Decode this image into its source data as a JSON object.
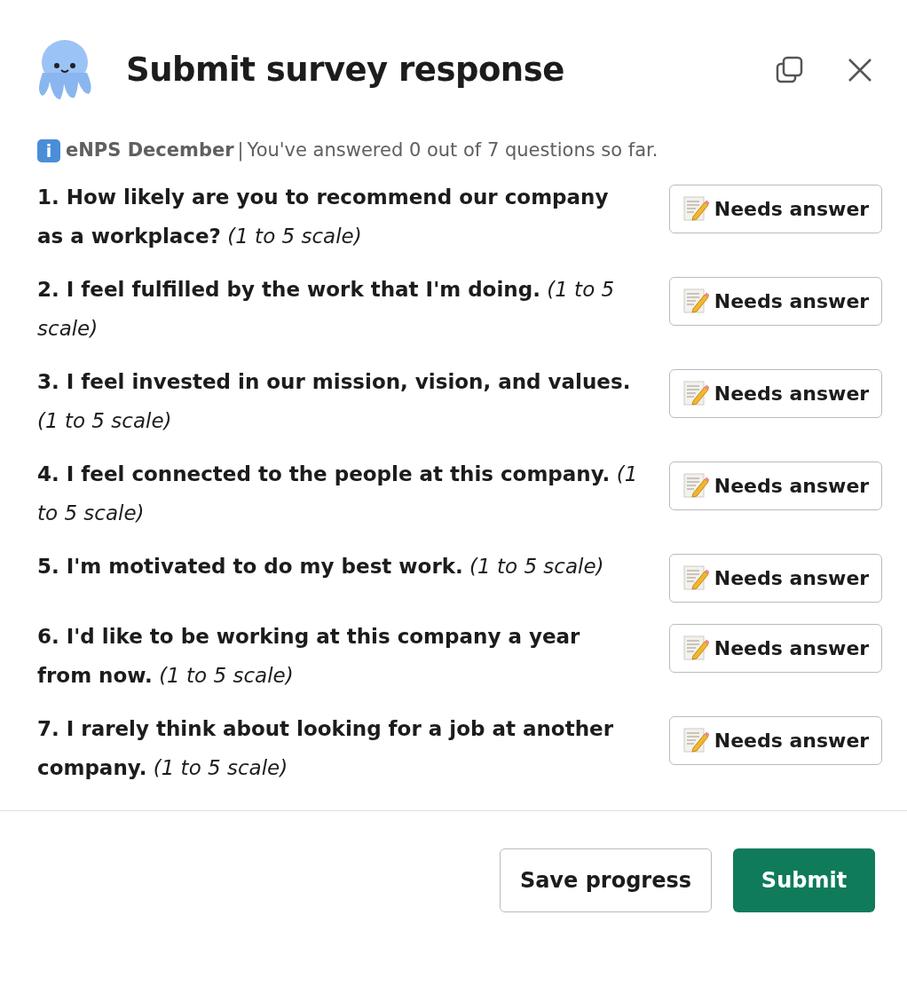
{
  "window": {
    "title": "Submit survey response"
  },
  "header": {
    "info_badge": "i",
    "survey_name": "eNPS December",
    "separator": "|",
    "progress_text": "You've answered 0 out of 7 questions so far."
  },
  "questions": [
    {
      "text": "**1. How likely are you to recommend our company as a workplace?** *(1 to 5 scale)*",
      "button": "Needs answer"
    },
    {
      "text": "**2. I feel fulfilled by the work that I'm doing.** *(1 to 5 scale)*",
      "button": "Needs answer"
    },
    {
      "text": "**3. I feel invested in our mission, vision, and values.** *(1 to 5 scale)*",
      "button": "Needs answer"
    },
    {
      "text": "**4. I feel connected to the people at this company.** *(1 to 5 scale)*",
      "button": "Needs answer"
    },
    {
      "text": "**5. I'm motivated to do my best work.** *(1 to 5 scale)*",
      "button": "Needs answer"
    },
    {
      "text": "**6. I'd like to be working at this company a year from now.** *(1 to 5 scale)*",
      "button": "Needs answer"
    },
    {
      "text": "**7. I rarely think about looking for a job at another company.** *(1 to 5 scale)*",
      "button": "Needs answer"
    }
  ],
  "buttons": [
    {
      "label": "Save progress",
      "kind": "secondary"
    },
    {
      "label": "Submit",
      "kind": "primary"
    }
  ]
}
